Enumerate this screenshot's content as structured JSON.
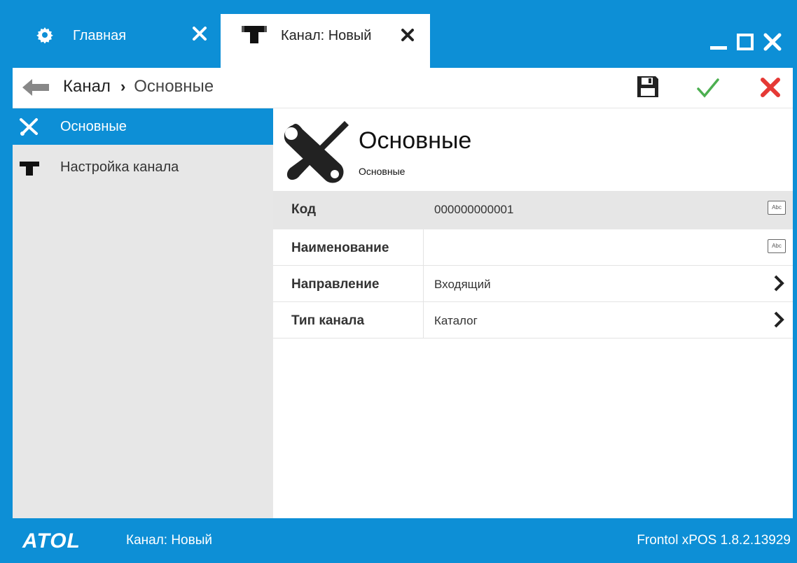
{
  "tabs": [
    {
      "label": "Главная",
      "icon": "gear-icon"
    },
    {
      "label": "Канал: Новый",
      "icon": "tee-icon"
    }
  ],
  "toolbar": {
    "breadcrumb_root": "Канал",
    "breadcrumb_separator": "›",
    "breadcrumb_current": "Основные"
  },
  "sidebar": {
    "items": [
      {
        "label": "Основные",
        "icon": "tools-icon",
        "active": true
      },
      {
        "label": "Настройка канала",
        "icon": "tee-icon",
        "active": false
      }
    ]
  },
  "main": {
    "title": "Основные",
    "subtitle": "Основные",
    "fields": [
      {
        "label": "Код",
        "value": "000000000001",
        "type": "text"
      },
      {
        "label": "Наименование",
        "value": "",
        "type": "text"
      },
      {
        "label": "Направление",
        "value": "Входящий",
        "type": "select"
      },
      {
        "label": "Тип канала",
        "value": "Каталог",
        "type": "select"
      }
    ],
    "text_badge": "Abc"
  },
  "status": {
    "logo": "ATOL",
    "left": "Канал: Новый",
    "right": "Frontol xPOS 1.8.2.13929"
  },
  "colors": {
    "accent": "#0d8fd6",
    "ok": "#3cb44b",
    "cancel": "#d9382b"
  }
}
